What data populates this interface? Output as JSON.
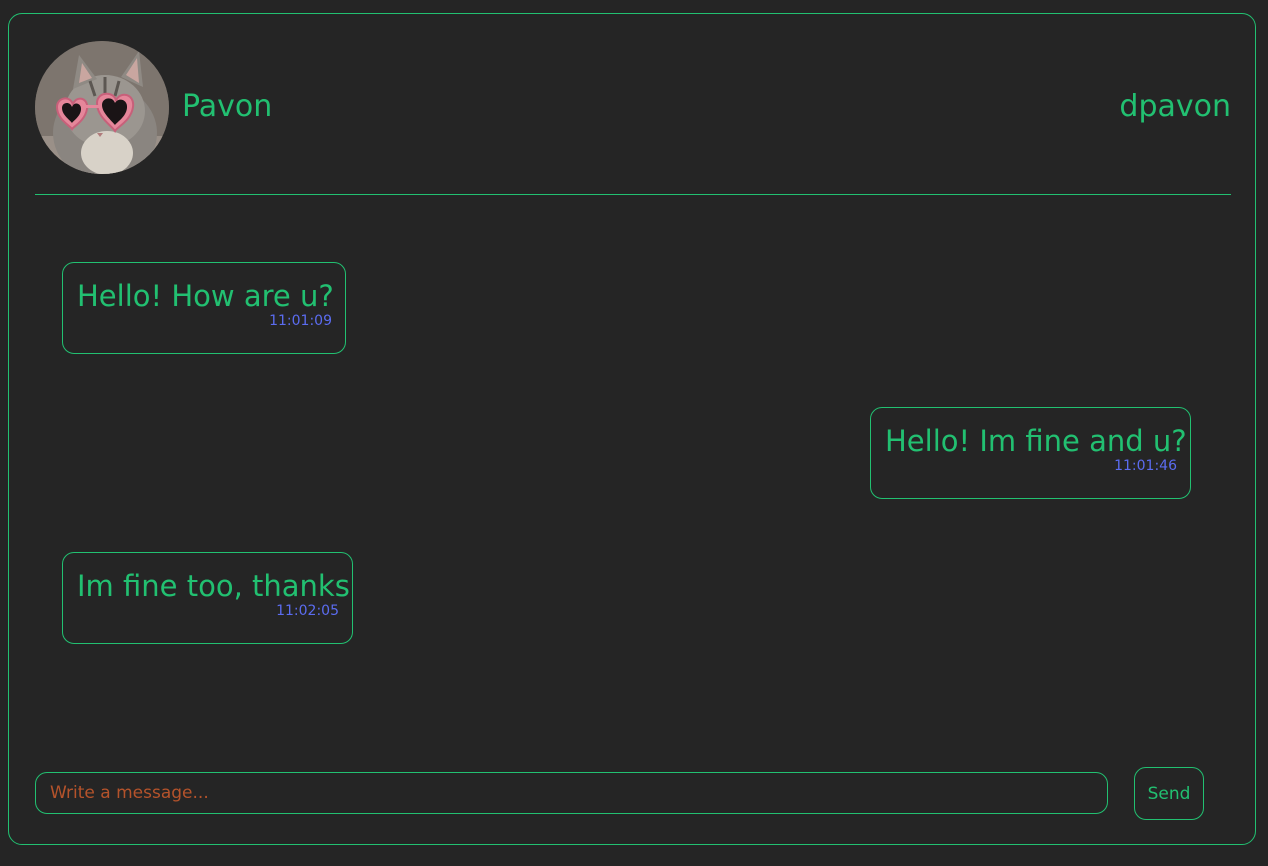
{
  "colors": {
    "background": "#252525",
    "accent": "#22c071",
    "timestamp": "#5b6cf0",
    "placeholder": "#b5532b"
  },
  "header": {
    "avatar_icon": "cat-with-heart-sunglasses-avatar",
    "contact_name": "Pavon",
    "username": "dpavon"
  },
  "messages": [
    {
      "text": "Hello! How are u?",
      "time": "11:01:09",
      "side": "left"
    },
    {
      "text": "Hello! Im fine and u?",
      "time": "11:01:46",
      "side": "right"
    },
    {
      "text": "Im fine too, thanks",
      "time": "11:02:05",
      "side": "left"
    }
  ],
  "composer": {
    "placeholder": "Write a message...",
    "value": "",
    "send_label": "Send"
  }
}
